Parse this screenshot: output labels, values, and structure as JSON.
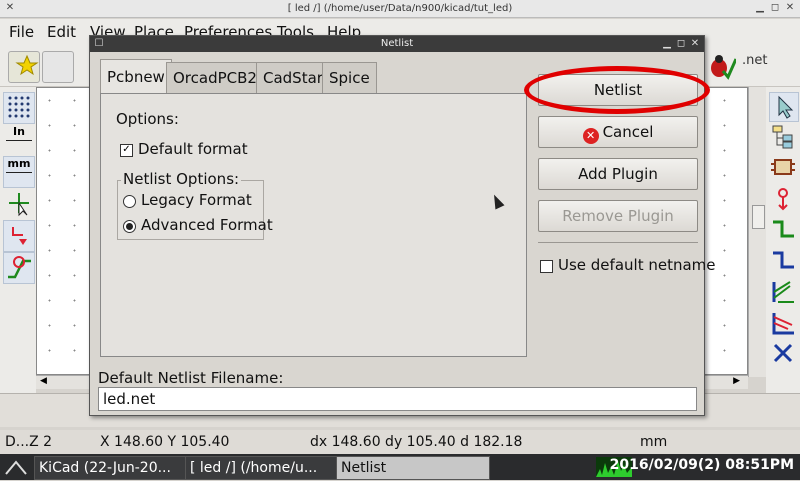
{
  "window": {
    "title": "[ led /] (/home/user/Data/n900/kicad/tut_led)"
  },
  "menu": [
    "File",
    "Edit",
    "View",
    "Place",
    "Preferences",
    "Tools",
    "Help"
  ],
  "toolbar": {
    "net_label": ".net"
  },
  "left_toolbar": {
    "in_label": "In",
    "mm_label": "mm"
  },
  "dialog": {
    "title": "Netlist",
    "tabs": [
      "Pcbnew",
      "OrcadPCB2",
      "CadStar",
      "Spice"
    ],
    "selected_tab": "Pcbnew",
    "options_label": "Options:",
    "default_format_label": "Default format",
    "default_format_checked": true,
    "netlist_options_label": "Netlist Options:",
    "legacy_label": "Legacy Format",
    "advanced_label": "Advanced Format",
    "selected_format": "Advanced Format",
    "buttons": {
      "netlist": "Netlist",
      "cancel": "Cancel",
      "add_plugin": "Add Plugin",
      "remove_plugin": "Remove Plugin"
    },
    "use_default_netname_label": "Use default netname",
    "use_default_netname_checked": false,
    "filename_label": "Default Netlist Filename:",
    "filename_value": "led.net",
    "highlight_color": "#e00000"
  },
  "status": {
    "left": "D...Z 2",
    "xy": "X 148.60  Y 105.40",
    "d": "dx 148.60  dy 105.40  d 182.18",
    "units": "mm"
  },
  "taskbar": {
    "items": [
      "KiCad (22-Jun-20...",
      "[ led /] (/home/u...",
      "Netlist"
    ],
    "clock": "2016/02/09(2) 08:51PM"
  }
}
